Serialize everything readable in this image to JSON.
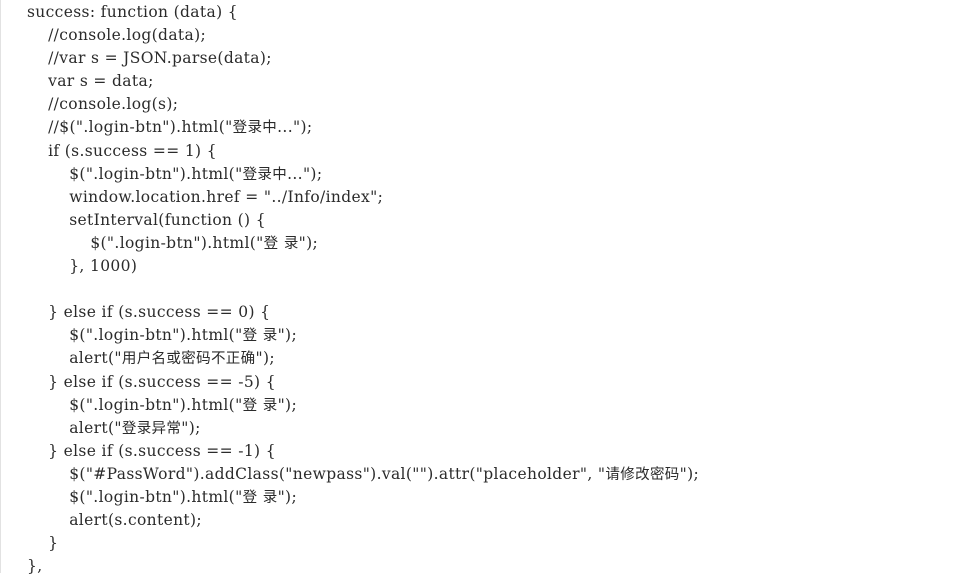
{
  "snippet": {
    "language": "javascript",
    "background_color": "#ffffff",
    "text_color": "#2b2b2b",
    "rule_color": "#e2e2e2",
    "lines": [
      {
        "indent": 0,
        "text": "success: function (data) {"
      },
      {
        "indent": 1,
        "text": "//console.log(data);"
      },
      {
        "indent": 1,
        "text": "//var s = JSON.parse(data);"
      },
      {
        "indent": 1,
        "text": "var s = data;"
      },
      {
        "indent": 1,
        "text": "//console.log(s);"
      },
      {
        "indent": 1,
        "text": "//$(\".login-btn\").html(\"登录中...\");"
      },
      {
        "indent": 1,
        "text": "if (s.success == 1) {"
      },
      {
        "indent": 2,
        "text": "$(\".login-btn\").html(\"登录中...\");"
      },
      {
        "indent": 2,
        "text": "window.location.href = \"../Info/index\";"
      },
      {
        "indent": 2,
        "text": "setInterval(function () {"
      },
      {
        "indent": 3,
        "text": "$(\".login-btn\").html(\"登 录\");"
      },
      {
        "indent": 2,
        "text": "}, 1000)"
      },
      {
        "indent": 0,
        "text": ""
      },
      {
        "indent": 1,
        "text": "} else if (s.success == 0) {"
      },
      {
        "indent": 2,
        "text": "$(\".login-btn\").html(\"登 录\");"
      },
      {
        "indent": 2,
        "text": "alert(\"用户名或密码不正确\");"
      },
      {
        "indent": 1,
        "text": "} else if (s.success == -5) {"
      },
      {
        "indent": 2,
        "text": "$(\".login-btn\").html(\"登 录\");"
      },
      {
        "indent": 2,
        "text": "alert(\"登录异常\");"
      },
      {
        "indent": 1,
        "text": "} else if (s.success == -1) {"
      },
      {
        "indent": 2,
        "text": "$(\"#PassWord\").addClass(\"newpass\").val(\"\").attr(\"placeholder\", \"请修改密码\");"
      },
      {
        "indent": 2,
        "text": "$(\".login-btn\").html(\"登 录\");"
      },
      {
        "indent": 2,
        "text": "alert(s.content);"
      },
      {
        "indent": 1,
        "text": "}"
      },
      {
        "indent": 0,
        "text": "},"
      }
    ]
  }
}
